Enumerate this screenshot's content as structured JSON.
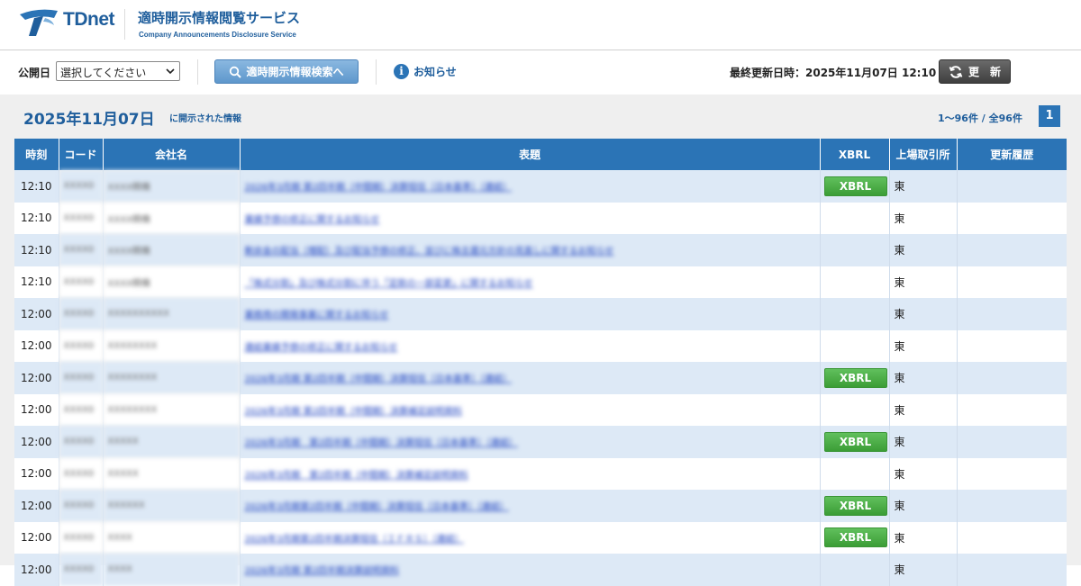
{
  "header": {
    "logo_text": "TDnet",
    "service_title": "適時開示情報閲覧サービス",
    "service_subtitle": "Company Announcements Disclosure Service"
  },
  "toolbar": {
    "pub_date_label": "公開日",
    "select_value": "選択してください",
    "search_label": "適時開示情報検索へ",
    "info_label": "お知らせ",
    "last_updated": "最終更新日時：2025年11月07日 12:10",
    "refresh_label": "更　新"
  },
  "main": {
    "date_heading": "2025年11月07日",
    "date_suffix": "に開示された情報",
    "count_text": "1～96件 / 全96件",
    "page": "1"
  },
  "table": {
    "headers": [
      "時刻",
      "コード",
      "会社名",
      "表題",
      "XBRL",
      "上場取引所",
      "更新履歴"
    ],
    "rows": [
      {
        "time": "12:10",
        "code": "XXXX0",
        "company": "XXXX精機",
        "title": "2026年3月期 第2四半期（中間期）決算短信〔日本基準〕（連結）",
        "xbrl": "XBRL",
        "exchange": "東"
      },
      {
        "time": "12:10",
        "code": "XXXX0",
        "company": "XXXX精機",
        "title": "業績予想の修正に関するお知らせ",
        "xbrl": "",
        "exchange": "東"
      },
      {
        "time": "12:10",
        "code": "XXXX0",
        "company": "XXXX精機",
        "title": "剰余金の配当（増配）及び配当予想の修正、並びに株主還元方針の見直しに関するお知らせ",
        "xbrl": "",
        "exchange": "東"
      },
      {
        "time": "12:10",
        "code": "XXXX0",
        "company": "XXXX精機",
        "title": "「株式分割」及び株式分割に伴う「定款の一部変更」に関するお知らせ",
        "xbrl": "",
        "exchange": "東"
      },
      {
        "time": "12:00",
        "code": "XXXX0",
        "company": "XXXXXXXXXX",
        "title": "業務用の開発事業に関するお知らせ",
        "xbrl": "",
        "exchange": "東"
      },
      {
        "time": "12:00",
        "code": "XXXX0",
        "company": "XXXXXXXX",
        "title": "連結業績予想の修正に関するお知らせ",
        "xbrl": "",
        "exchange": "東"
      },
      {
        "time": "12:00",
        "code": "XXXX0",
        "company": "XXXXXXXX",
        "title": "2026年3月期 第2四半期（中間期）決算短信〔日本基準〕（連結）",
        "xbrl": "XBRL",
        "exchange": "東"
      },
      {
        "time": "12:00",
        "code": "XXXX0",
        "company": "XXXXXXXX",
        "title": "2026年3月期 第2四半期（中間期）決算補足説明資料",
        "xbrl": "",
        "exchange": "東"
      },
      {
        "time": "12:00",
        "code": "XXXX0",
        "company": "XXXXX",
        "title": "2026年3月期　第2四半期（中間期）決算短信〔日本基準〕（連結）",
        "xbrl": "XBRL",
        "exchange": "東"
      },
      {
        "time": "12:00",
        "code": "XXXX0",
        "company": "XXXXX",
        "title": "2026年3月期　第2四半期（中間期）決算補足説明資料",
        "xbrl": "",
        "exchange": "東"
      },
      {
        "time": "12:00",
        "code": "XXXX0",
        "company": "XXXXXX",
        "title": "2026年3月期第2四半期（中間期）決算短信〔日本基準〕（連結）",
        "xbrl": "XBRL",
        "exchange": "東"
      },
      {
        "time": "12:00",
        "code": "XXXX0",
        "company": "XXXX",
        "title": "2026年3月期第2四半期決算短信〔ＩＦＲＳ〕（連結）",
        "xbrl": "XBRL",
        "exchange": "東"
      },
      {
        "time": "12:00",
        "code": "XXXX0",
        "company": "XXXX",
        "title": "2026年3月期 第2四半期決算説明資料",
        "xbrl": "",
        "exchange": "東"
      }
    ]
  },
  "colors": {
    "brand_blue": "#2b74b6",
    "row_alt": "#dde9f6",
    "xbrl_green": "#3b9d36",
    "link_blue": "#1a3fbf"
  }
}
